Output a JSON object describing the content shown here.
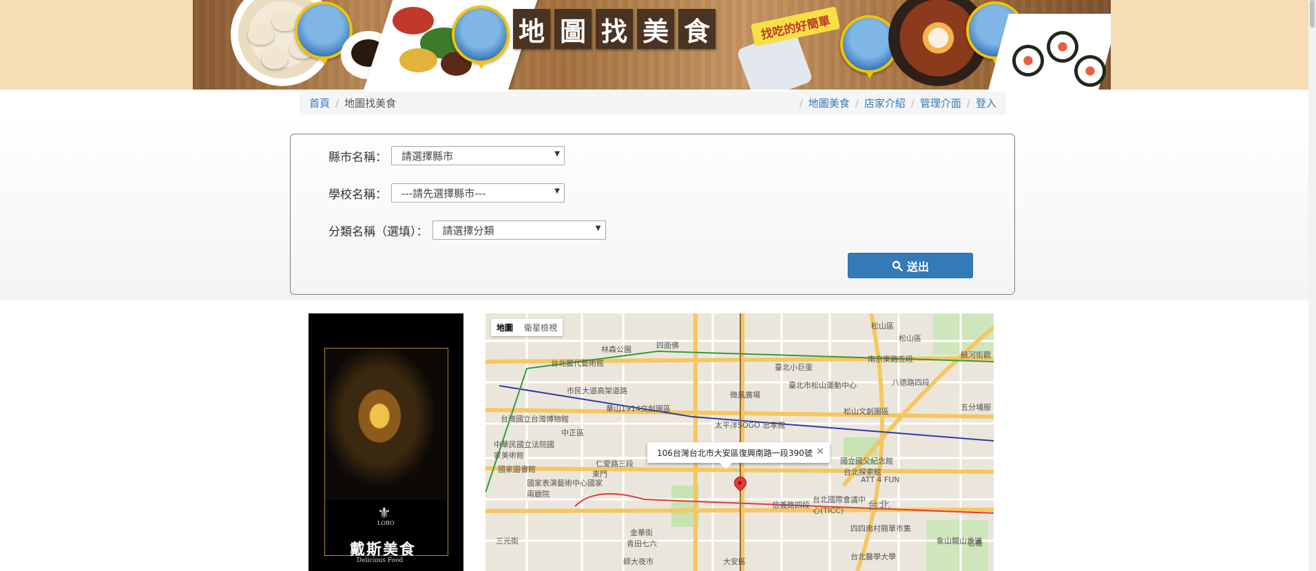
{
  "banner": {
    "title_chars": [
      "地",
      "圖",
      "找",
      "美",
      "食"
    ],
    "slogan": "找吃的好簡單"
  },
  "breadcrumb": {
    "home": "首頁",
    "current": "地圖找美食",
    "nav": [
      "地圖美食",
      "店家介紹",
      "管理介面",
      "登入"
    ]
  },
  "form": {
    "city_label": "縣市名稱：",
    "city_value": "請選擇縣市",
    "school_label": "學校名稱：",
    "school_value": "---請先選擇縣市---",
    "category_label": "分類名稱（選填）：",
    "category_value": "請選擇分類",
    "submit_label": "送出"
  },
  "ad": {
    "fleur": "⚜",
    "logo_text": "LOBO",
    "brand": "戴斯美食",
    "sub": "Delicious Food"
  },
  "map": {
    "type_map": "地圖",
    "type_satellite": "衛星檢視",
    "info_address": "106台灣台北市大安區復興南路一段390號",
    "close_glyph": "✕",
    "labels": {
      "l1": "四面佛",
      "l2": "松山區",
      "l3": "台北當代藝術館",
      "l4": "臺北小巨蛋",
      "l5": "林森公園",
      "l6": "市民大道高架道路",
      "l7": "臺北市松山運動中心",
      "l8": "八德路四段",
      "l9": "微風廣場",
      "l10": "華山1914文創園區",
      "l11": "松山文創園區",
      "l12": "台灣國立台灣博物館",
      "l13": "太平洋SOGO 忠孝館",
      "l14": "五分埔服",
      "l15": "中正區",
      "l16": "中華民國立法院國家美術館",
      "l17": "國立國父紀念館",
      "l18": "國家圖書館",
      "l19": "東門",
      "l20": "台北探索館",
      "l21": "國家表演藝術中心國家兩廳院",
      "l22": "ATT 4 FUN",
      "l23": "台北國際會議中心(TICC)",
      "l24": "台北",
      "l25": "四四南村簡單市集",
      "l26": "金華街",
      "l27": "青田七六",
      "l28": "象山親山步道",
      "l29": "三元街",
      "l30": "師大夜市",
      "l31": "大安區",
      "l32": "台北醫學大學",
      "l33": "信義路四段",
      "l34": "松山區",
      "l35": "南京東路五段",
      "l36": "饒河街觀",
      "l37": "仁愛路三段",
      "l38": "信義"
    }
  }
}
